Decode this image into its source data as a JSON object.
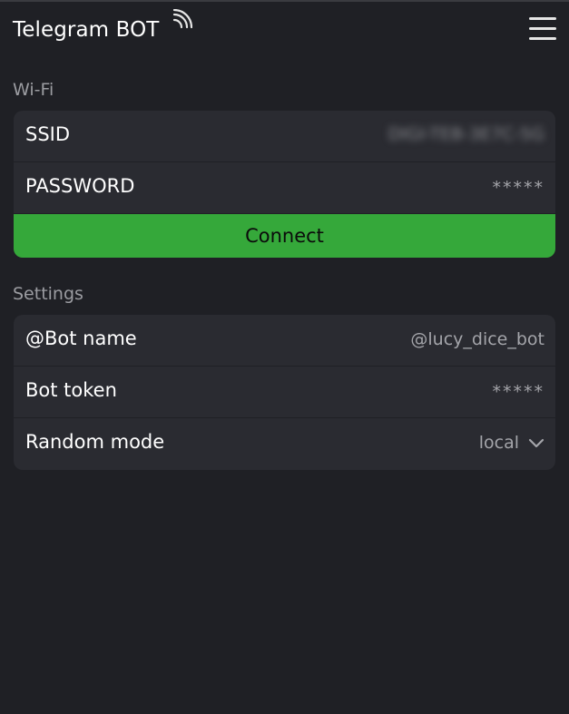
{
  "header": {
    "title": "Telegram BOT",
    "wifi_icon": "wifi-icon",
    "menu_icon": "hamburger-menu-icon"
  },
  "wifi": {
    "section_label": "Wi-Fi",
    "ssid_label": "SSID",
    "ssid_value": "DIGI-TEB-3E7C-5G",
    "password_label": "PASSWORD",
    "password_value": "*****",
    "connect_label": "Connect"
  },
  "settings": {
    "section_label": "Settings",
    "bot_name_label": "@Bot name",
    "bot_name_value": "@lucy_dice_bot",
    "bot_token_label": "Bot token",
    "bot_token_value": "*****",
    "random_mode_label": "Random mode",
    "random_mode_value": "local"
  },
  "colors": {
    "background": "#1f2025",
    "card": "#2a2b31",
    "accent_green": "#35a83a",
    "muted_text": "#9b9ca1"
  }
}
